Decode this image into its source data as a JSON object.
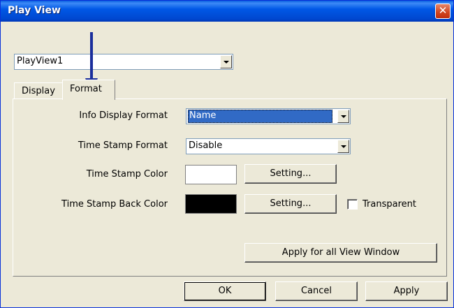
{
  "window": {
    "title": "Play View",
    "close_glyph": "✕"
  },
  "view_select": {
    "value": "PlayView1"
  },
  "tabs": [
    {
      "label": "Display"
    },
    {
      "label": "Format",
      "selected": true
    }
  ],
  "format": {
    "info_display_label": "Info Display Format",
    "info_display_value": "Name",
    "time_stamp_format_label": "Time Stamp Format",
    "time_stamp_format_value": "Disable",
    "time_stamp_color_label": "Time Stamp Color",
    "time_stamp_color": "#FFFFFF",
    "time_stamp_back_color_label": "Time Stamp Back Color",
    "time_stamp_back_color": "#000000",
    "setting_label": "Setting...",
    "transparent_label": "Transparent",
    "transparent_checked": false,
    "apply_all_label": "Apply for all View Window"
  },
  "buttons": {
    "ok": "OK",
    "cancel": "Cancel",
    "apply": "Apply"
  },
  "annotation": {
    "arrow_color": "#1A2E9C"
  },
  "colors": {
    "title_bar": "#0058E6",
    "highlight": "#316AC5",
    "dialog_bg": "#ECE9D8"
  }
}
